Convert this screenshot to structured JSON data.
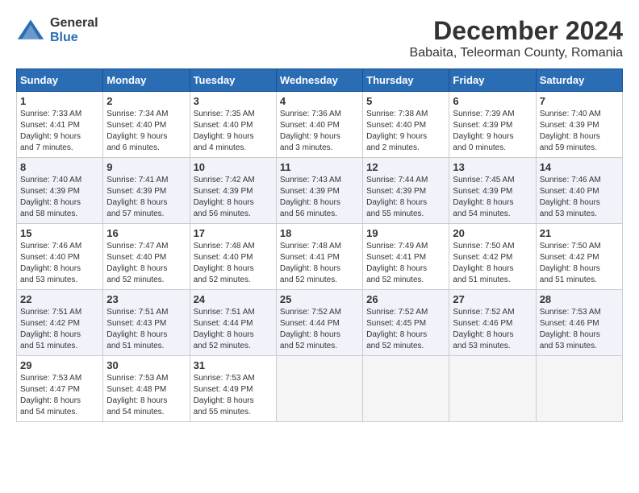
{
  "logo": {
    "general": "General",
    "blue": "Blue"
  },
  "title": "December 2024",
  "subtitle": "Babaita, Teleorman County, Romania",
  "days_of_week": [
    "Sunday",
    "Monday",
    "Tuesday",
    "Wednesday",
    "Thursday",
    "Friday",
    "Saturday"
  ],
  "weeks": [
    [
      {
        "day": "1",
        "info": "Sunrise: 7:33 AM\nSunset: 4:41 PM\nDaylight: 9 hours\nand 7 minutes."
      },
      {
        "day": "2",
        "info": "Sunrise: 7:34 AM\nSunset: 4:40 PM\nDaylight: 9 hours\nand 6 minutes."
      },
      {
        "day": "3",
        "info": "Sunrise: 7:35 AM\nSunset: 4:40 PM\nDaylight: 9 hours\nand 4 minutes."
      },
      {
        "day": "4",
        "info": "Sunrise: 7:36 AM\nSunset: 4:40 PM\nDaylight: 9 hours\nand 3 minutes."
      },
      {
        "day": "5",
        "info": "Sunrise: 7:38 AM\nSunset: 4:40 PM\nDaylight: 9 hours\nand 2 minutes."
      },
      {
        "day": "6",
        "info": "Sunrise: 7:39 AM\nSunset: 4:39 PM\nDaylight: 9 hours\nand 0 minutes."
      },
      {
        "day": "7",
        "info": "Sunrise: 7:40 AM\nSunset: 4:39 PM\nDaylight: 8 hours\nand 59 minutes."
      }
    ],
    [
      {
        "day": "8",
        "info": "Sunrise: 7:40 AM\nSunset: 4:39 PM\nDaylight: 8 hours\nand 58 minutes."
      },
      {
        "day": "9",
        "info": "Sunrise: 7:41 AM\nSunset: 4:39 PM\nDaylight: 8 hours\nand 57 minutes."
      },
      {
        "day": "10",
        "info": "Sunrise: 7:42 AM\nSunset: 4:39 PM\nDaylight: 8 hours\nand 56 minutes."
      },
      {
        "day": "11",
        "info": "Sunrise: 7:43 AM\nSunset: 4:39 PM\nDaylight: 8 hours\nand 56 minutes."
      },
      {
        "day": "12",
        "info": "Sunrise: 7:44 AM\nSunset: 4:39 PM\nDaylight: 8 hours\nand 55 minutes."
      },
      {
        "day": "13",
        "info": "Sunrise: 7:45 AM\nSunset: 4:39 PM\nDaylight: 8 hours\nand 54 minutes."
      },
      {
        "day": "14",
        "info": "Sunrise: 7:46 AM\nSunset: 4:40 PM\nDaylight: 8 hours\nand 53 minutes."
      }
    ],
    [
      {
        "day": "15",
        "info": "Sunrise: 7:46 AM\nSunset: 4:40 PM\nDaylight: 8 hours\nand 53 minutes."
      },
      {
        "day": "16",
        "info": "Sunrise: 7:47 AM\nSunset: 4:40 PM\nDaylight: 8 hours\nand 52 minutes."
      },
      {
        "day": "17",
        "info": "Sunrise: 7:48 AM\nSunset: 4:40 PM\nDaylight: 8 hours\nand 52 minutes."
      },
      {
        "day": "18",
        "info": "Sunrise: 7:48 AM\nSunset: 4:41 PM\nDaylight: 8 hours\nand 52 minutes."
      },
      {
        "day": "19",
        "info": "Sunrise: 7:49 AM\nSunset: 4:41 PM\nDaylight: 8 hours\nand 52 minutes."
      },
      {
        "day": "20",
        "info": "Sunrise: 7:50 AM\nSunset: 4:42 PM\nDaylight: 8 hours\nand 51 minutes."
      },
      {
        "day": "21",
        "info": "Sunrise: 7:50 AM\nSunset: 4:42 PM\nDaylight: 8 hours\nand 51 minutes."
      }
    ],
    [
      {
        "day": "22",
        "info": "Sunrise: 7:51 AM\nSunset: 4:42 PM\nDaylight: 8 hours\nand 51 minutes."
      },
      {
        "day": "23",
        "info": "Sunrise: 7:51 AM\nSunset: 4:43 PM\nDaylight: 8 hours\nand 51 minutes."
      },
      {
        "day": "24",
        "info": "Sunrise: 7:51 AM\nSunset: 4:44 PM\nDaylight: 8 hours\nand 52 minutes."
      },
      {
        "day": "25",
        "info": "Sunrise: 7:52 AM\nSunset: 4:44 PM\nDaylight: 8 hours\nand 52 minutes."
      },
      {
        "day": "26",
        "info": "Sunrise: 7:52 AM\nSunset: 4:45 PM\nDaylight: 8 hours\nand 52 minutes."
      },
      {
        "day": "27",
        "info": "Sunrise: 7:52 AM\nSunset: 4:46 PM\nDaylight: 8 hours\nand 53 minutes."
      },
      {
        "day": "28",
        "info": "Sunrise: 7:53 AM\nSunset: 4:46 PM\nDaylight: 8 hours\nand 53 minutes."
      }
    ],
    [
      {
        "day": "29",
        "info": "Sunrise: 7:53 AM\nSunset: 4:47 PM\nDaylight: 8 hours\nand 54 minutes."
      },
      {
        "day": "30",
        "info": "Sunrise: 7:53 AM\nSunset: 4:48 PM\nDaylight: 8 hours\nand 54 minutes."
      },
      {
        "day": "31",
        "info": "Sunrise: 7:53 AM\nSunset: 4:49 PM\nDaylight: 8 hours\nand 55 minutes."
      },
      {
        "day": "",
        "info": ""
      },
      {
        "day": "",
        "info": ""
      },
      {
        "day": "",
        "info": ""
      },
      {
        "day": "",
        "info": ""
      }
    ]
  ]
}
